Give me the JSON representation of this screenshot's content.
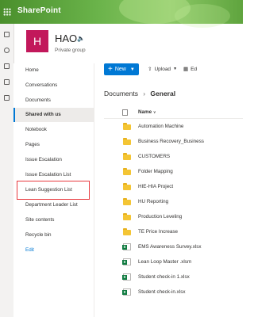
{
  "suite": {
    "brand": "SharePoint"
  },
  "site": {
    "logo_letter": "H",
    "title": "HAO",
    "subtitle": "Private group"
  },
  "nav": {
    "items": [
      "Home",
      "Conversations",
      "Documents",
      "Shared with us",
      "Notebook",
      "Pages",
      "Issue Escalation",
      "Issue Escalation List",
      "Lean Suggestion List",
      "Department Leader List",
      "Site contents",
      "Recycle bin"
    ],
    "selected": "Shared with us",
    "highlighted": "Lean Suggestion List",
    "edit_label": "Edit"
  },
  "toolbar": {
    "new_label": "New",
    "upload_label": "Upload",
    "edit_label_partial": "Ed"
  },
  "breadcrumb": {
    "parent": "Documents",
    "current": "General"
  },
  "list": {
    "column_name": "Name",
    "rows": [
      {
        "type": "folder",
        "name": "Automation Machine"
      },
      {
        "type": "folder",
        "name": "Business Recovery_Business"
      },
      {
        "type": "folder",
        "name": "CUSTOMERS"
      },
      {
        "type": "folder",
        "name": "Folder Mapping"
      },
      {
        "type": "folder",
        "name": "HIE-HIA Project"
      },
      {
        "type": "folder",
        "name": "HU Reporting"
      },
      {
        "type": "folder",
        "name": "Production Leveling"
      },
      {
        "type": "folder",
        "name": "TE Price Increase"
      },
      {
        "type": "xlsx",
        "name": "EMS Awareness Survey.xlsx"
      },
      {
        "type": "xlsx",
        "name": "Lean Loop Master .xlsm"
      },
      {
        "type": "xlsx",
        "name": "Student check-in 1.xlsx"
      },
      {
        "type": "xlsx",
        "name": "Student check-in.xlsx"
      }
    ]
  },
  "colors": {
    "accent": "#0078d4",
    "site_logo": "#c2185b",
    "highlight": "#e8383d"
  }
}
